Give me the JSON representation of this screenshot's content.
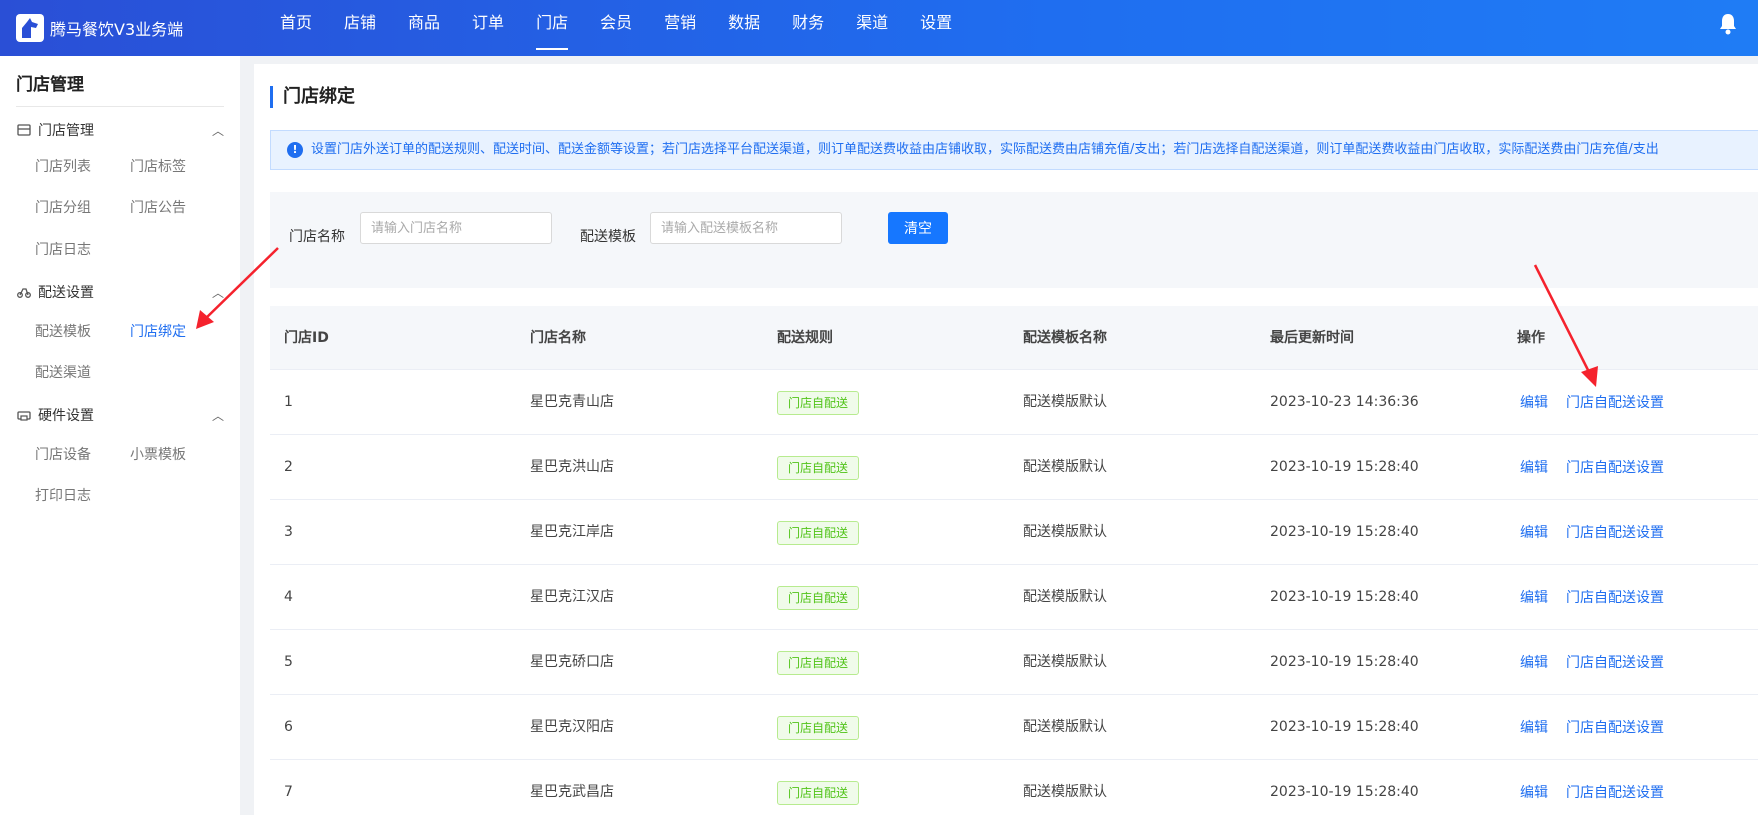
{
  "app": {
    "title": "腾马餐饮V3业务端"
  },
  "nav": [
    "首页",
    "店铺",
    "商品",
    "订单",
    "门店",
    "会员",
    "营销",
    "数据",
    "财务",
    "渠道",
    "设置"
  ],
  "nav_active": "门店",
  "sidebar": {
    "title": "门店管理",
    "groups": [
      {
        "label": "门店管理",
        "icon": "store-icon",
        "items": [
          "门店列表",
          "门店标签",
          "门店分组",
          "门店公告",
          "门店日志"
        ]
      },
      {
        "label": "配送设置",
        "icon": "delivery-icon",
        "items": [
          "配送模板",
          "门店绑定",
          "配送渠道"
        ]
      },
      {
        "label": "硬件设置",
        "icon": "printer-icon",
        "items": [
          "门店设备",
          "小票模板",
          "打印日志"
        ]
      }
    ],
    "active_item": "门店绑定"
  },
  "page": {
    "title": "门店绑定",
    "notice": "设置门店外送订单的配送规则、配送时间、配送金额等设置；若门店选择平台配送渠道，则订单配送费收益由店铺收取，实际配送费由店铺充值/支出；若门店选择自配送渠道，则订单配送费收益由门店收取，实际配送费由门店充值/支出"
  },
  "filter": {
    "store_name_label": "门店名称",
    "store_name_placeholder": "请输入门店名称",
    "template_label": "配送模板",
    "template_placeholder": "请输入配送模板名称",
    "clear_label": "清空"
  },
  "table": {
    "headers": [
      "门店ID",
      "门店名称",
      "配送规则",
      "配送模板名称",
      "最后更新时间",
      "操作"
    ],
    "rows": [
      {
        "id": "1",
        "name": "星巴克青山店",
        "rule": "门店自配送",
        "template": "配送模版默认",
        "updated": "2023-10-23 14:36:36"
      },
      {
        "id": "2",
        "name": "星巴克洪山店",
        "rule": "门店自配送",
        "template": "配送模版默认",
        "updated": "2023-10-19 15:28:40"
      },
      {
        "id": "3",
        "name": "星巴克江岸店",
        "rule": "门店自配送",
        "template": "配送模版默认",
        "updated": "2023-10-19 15:28:40"
      },
      {
        "id": "4",
        "name": "星巴克江汉店",
        "rule": "门店自配送",
        "template": "配送模版默认",
        "updated": "2023-10-19 15:28:40"
      },
      {
        "id": "5",
        "name": "星巴克硚口店",
        "rule": "门店自配送",
        "template": "配送模版默认",
        "updated": "2023-10-19 15:28:40"
      },
      {
        "id": "6",
        "name": "星巴克汉阳店",
        "rule": "门店自配送",
        "template": "配送模版默认",
        "updated": "2023-10-19 15:28:40"
      },
      {
        "id": "7",
        "name": "星巴克武昌店",
        "rule": "门店自配送",
        "template": "配送模版默认",
        "updated": "2023-10-19 15:28:40"
      }
    ],
    "actions": {
      "edit": "编辑",
      "settings": "门店自配送设置"
    }
  },
  "colors": {
    "primary": "#1f6ef0",
    "tag_green": "#52c41a",
    "annotation_red": "#f5222d"
  }
}
